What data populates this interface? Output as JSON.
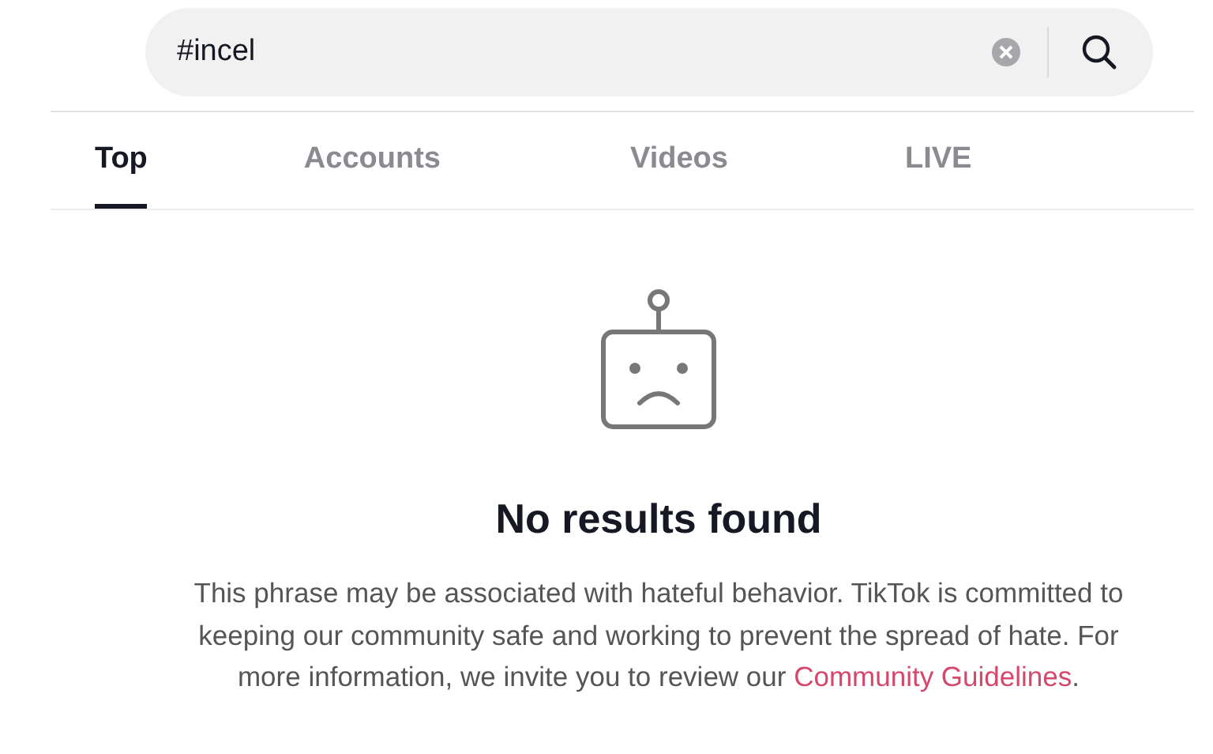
{
  "search": {
    "value": "#incel"
  },
  "tabs": [
    {
      "label": "Top",
      "selected": true
    },
    {
      "label": "Accounts",
      "selected": false
    },
    {
      "label": "Videos",
      "selected": false
    },
    {
      "label": "LIVE",
      "selected": false
    }
  ],
  "empty_state": {
    "title": "No results found",
    "message": "This phrase may be associated with hateful behavior. TikTok is committed to keeping our community safe and working to prevent the spread of hate. For more information, we invite you to review our",
    "link": "Community Guidelines",
    "suffix": "."
  }
}
